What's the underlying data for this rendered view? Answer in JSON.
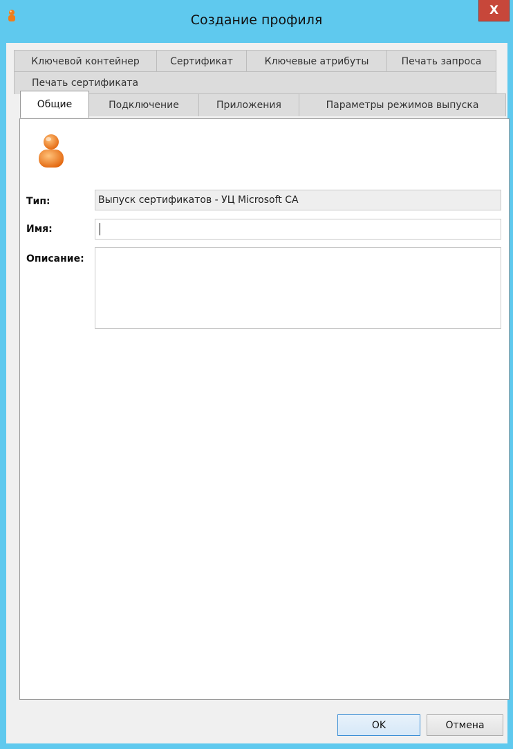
{
  "window": {
    "title": "Создание профиля",
    "close_label": "X"
  },
  "tabs": {
    "row1": [
      "Ключевой контейнер",
      "Сертификат",
      "Ключевые атрибуты",
      "Печать запроса"
    ],
    "row2": [
      "Печать сертификата"
    ],
    "row3": [
      "Общие",
      "Подключение",
      "Приложения",
      "Параметры режимов выпуска"
    ],
    "active": "Общие"
  },
  "form": {
    "type_label": "Тип:",
    "type_value": "Выпуск сертификатов - УЦ Microsoft CA",
    "name_label": "Имя:",
    "name_value": "",
    "description_label": "Описание:",
    "description_value": ""
  },
  "buttons": {
    "ok_label": "OK",
    "cancel_label": "Отмена"
  },
  "colors": {
    "titlebar": "#5fc9ee",
    "close": "#c7473a",
    "icon_orange": "#f07d1a"
  }
}
